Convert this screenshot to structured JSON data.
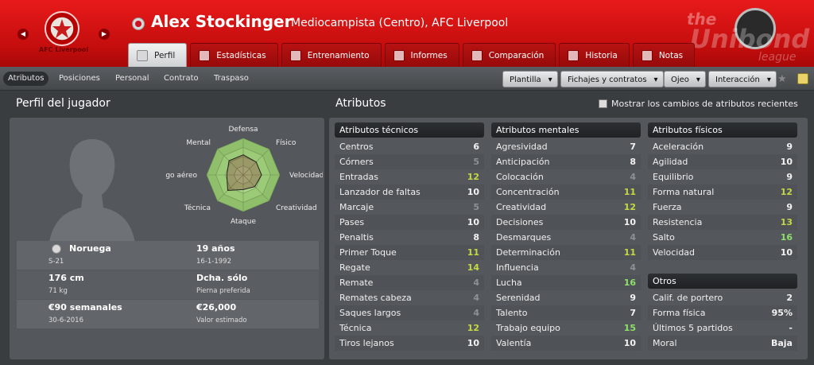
{
  "header": {
    "club_name": "AFC Liverpool",
    "player_name": "Alex Stockinger",
    "player_subtitle": "Mediocampista (Centro), AFC Liverpool",
    "league_text_1": "the",
    "league_text_2": "Unibond",
    "league_text_3": "league",
    "tabs": [
      {
        "label": "Perfil",
        "icon": "profile-icon",
        "active": true
      },
      {
        "label": "Estadísticas",
        "icon": "stats-icon"
      },
      {
        "label": "Entrenamiento",
        "icon": "training-icon"
      },
      {
        "label": "Informes",
        "icon": "report-icon"
      },
      {
        "label": "Comparación",
        "icon": "compare-icon"
      },
      {
        "label": "Historia",
        "icon": "history-icon"
      },
      {
        "label": "Notas",
        "icon": "notes-icon"
      }
    ]
  },
  "toolbar": {
    "subtabs": [
      "Atributos",
      "Posiciones",
      "Personal",
      "Contrato",
      "Traspaso"
    ],
    "dropdowns": [
      "Plantilla",
      "Fichajes y contratos",
      "Ojeo",
      "Interacción"
    ]
  },
  "profile": {
    "title": "Perfil del jugador",
    "radar_labels": [
      "Defensa",
      "Físico",
      "Velocidad",
      "Creatividad",
      "Ataque",
      "Técnica",
      "go aéreo",
      "Mental"
    ],
    "radar_values": [
      0.55,
      0.5,
      0.5,
      0.45,
      0.4,
      0.6,
      0.45,
      0.55
    ],
    "info": [
      {
        "left_bold": "Noruega",
        "left_small": "S-21",
        "right_bold": "19 años",
        "right_small": "16-1-1992"
      },
      {
        "left_bold": "176 cm",
        "left_small": "71 kg",
        "right_bold": "Dcha. sólo",
        "right_small": "Pierna preferida"
      },
      {
        "left_bold": "€90 semanales",
        "left_small": "30-6-2016",
        "right_bold": "€26,000",
        "right_small": "Valor estimado"
      }
    ]
  },
  "attributes": {
    "title": "Atributos",
    "show_changes_label": "Mostrar los cambios de atributos recientes",
    "technical": {
      "heading": "Atributos técnicos",
      "rows": [
        {
          "name": "Centros",
          "value": "6"
        },
        {
          "name": "Córners",
          "value": "5"
        },
        {
          "name": "Entradas",
          "value": "12"
        },
        {
          "name": "Lanzador de faltas",
          "value": "10"
        },
        {
          "name": "Marcaje",
          "value": "5"
        },
        {
          "name": "Pases",
          "value": "10"
        },
        {
          "name": "Penaltis",
          "value": "8"
        },
        {
          "name": "Primer Toque",
          "value": "11"
        },
        {
          "name": "Regate",
          "value": "14"
        },
        {
          "name": "Remate",
          "value": "4"
        },
        {
          "name": "Remates cabeza",
          "value": "4"
        },
        {
          "name": "Saques largos",
          "value": "4"
        },
        {
          "name": "Técnica",
          "value": "12"
        },
        {
          "name": "Tiros lejanos",
          "value": "10"
        }
      ]
    },
    "mental": {
      "heading": "Atributos mentales",
      "rows": [
        {
          "name": "Agresividad",
          "value": "7"
        },
        {
          "name": "Anticipación",
          "value": "8"
        },
        {
          "name": "Colocación",
          "value": "4"
        },
        {
          "name": "Concentración",
          "value": "11"
        },
        {
          "name": "Creatividad",
          "value": "12"
        },
        {
          "name": "Decisiones",
          "value": "10"
        },
        {
          "name": "Desmarques",
          "value": "4"
        },
        {
          "name": "Determinación",
          "value": "11"
        },
        {
          "name": "Influencia",
          "value": "4"
        },
        {
          "name": "Lucha",
          "value": "16"
        },
        {
          "name": "Serenidad",
          "value": "9"
        },
        {
          "name": "Talento",
          "value": "7"
        },
        {
          "name": "Trabajo equipo",
          "value": "15"
        },
        {
          "name": "Valentía",
          "value": "10"
        }
      ]
    },
    "physical": {
      "heading": "Atributos físicos",
      "rows": [
        {
          "name": "Aceleración",
          "value": "9"
        },
        {
          "name": "Agilidad",
          "value": "10"
        },
        {
          "name": "Equilibrio",
          "value": "9"
        },
        {
          "name": "Forma natural",
          "value": "12"
        },
        {
          "name": "Fuerza",
          "value": "9"
        },
        {
          "name": "Resistencia",
          "value": "13"
        },
        {
          "name": "Salto",
          "value": "16"
        },
        {
          "name": "Velocidad",
          "value": "10"
        }
      ]
    },
    "other": {
      "heading": "Otros",
      "rows": [
        {
          "name": "Calif. de portero",
          "value": "2"
        },
        {
          "name": "Forma física",
          "value": "95%"
        },
        {
          "name": "Últimos 5 partidos",
          "value": "-"
        },
        {
          "name": "Moral",
          "value": "Baja"
        }
      ]
    }
  },
  "colors": {
    "header_red": "#d41111",
    "value_high": "#c4d943",
    "value_very_high": "#8fe06a",
    "value_low": "#8e9194"
  }
}
